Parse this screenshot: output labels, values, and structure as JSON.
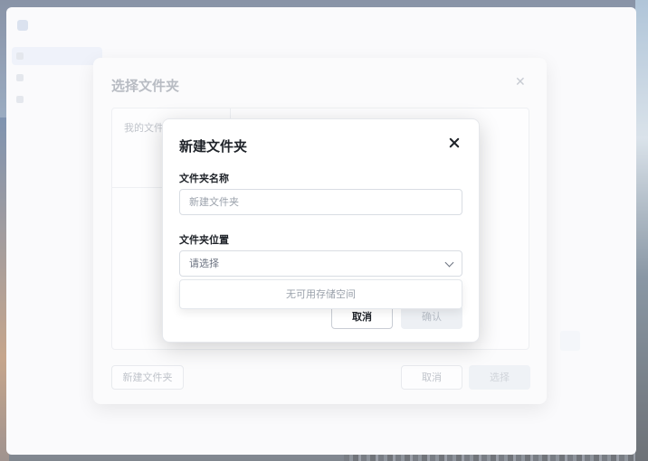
{
  "app": {
    "name": "",
    "subtitle": "",
    "sidebar": [],
    "footer": ""
  },
  "chooser": {
    "title": "选择文件夹",
    "close_icon": "close-icon",
    "tree_root": "我的文件",
    "new_folder_button": "新建文件夹",
    "cancel_button": "取消",
    "select_button": "选择"
  },
  "modal": {
    "title": "新建文件夹",
    "close_icon": "close-icon",
    "name_label": "文件夹名称",
    "name_placeholder": "新建文件夹",
    "name_value": "",
    "location_label": "文件夹位置",
    "location_placeholder": "请选择",
    "dropdown_empty": "无可用存储空间",
    "cancel_button": "取消",
    "confirm_button": "确认"
  },
  "colors": {
    "accent": "#1f2329",
    "muted": "#9aa1ab",
    "disabled_bg": "#edf0f4"
  }
}
